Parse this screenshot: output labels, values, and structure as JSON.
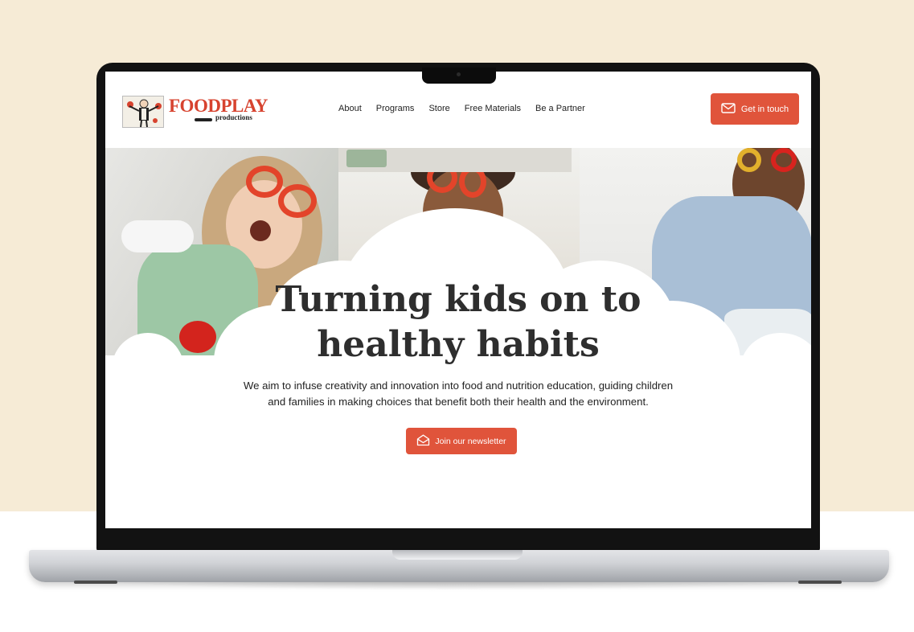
{
  "brand": {
    "logo_word": "FOODPLAY",
    "logo_sub": "productions"
  },
  "nav": {
    "items": [
      "About",
      "Programs",
      "Store",
      "Free Materials",
      "Be a Partner"
    ]
  },
  "header_cta": {
    "label": "Get in touch",
    "icon": "mail-icon"
  },
  "hero": {
    "headline_line1": "Turning kids on to",
    "headline_line2": "healthy habits",
    "description_line1": "We aim to infuse creativity and innovation into food and nutrition education, guiding children",
    "description_line2": "and families in making choices that benefit both their health and the environment.",
    "cta_label": "Join our newsletter",
    "cta_icon": "envelope-open-icon"
  },
  "colors": {
    "accent": "#e0543b",
    "page_background": "#f6ebd6",
    "headline": "#2e2e2e"
  }
}
